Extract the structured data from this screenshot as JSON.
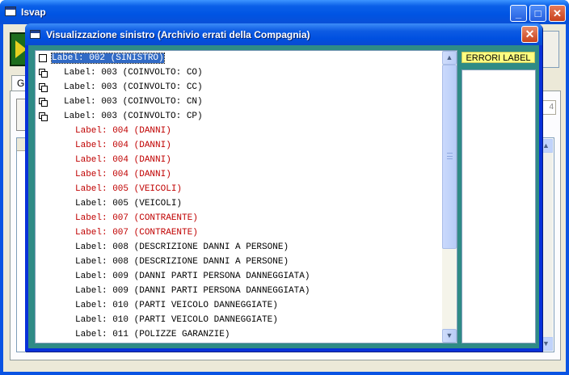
{
  "main_window": {
    "title": "Isvap",
    "tab_label": "G",
    "field_value": "4",
    "minimize_glyph": "_",
    "maximize_glyph": "□",
    "close_glyph": "✕"
  },
  "dialog": {
    "title": "Visualizzazione sinistro (Archivio errati della Compagnia)",
    "close_glyph": "✕",
    "errors_header": "ERRORI LABEL",
    "tree_rows": [
      {
        "text": "Label: 002 (SINISTRO)",
        "level": 0,
        "error": false,
        "selected": true,
        "expander": "box"
      },
      {
        "text": "Label: 003 (COINVOLTO: CO)",
        "level": 1,
        "error": false,
        "selected": false,
        "expander": "node"
      },
      {
        "text": "Label: 003 (COINVOLTO: CC)",
        "level": 1,
        "error": false,
        "selected": false,
        "expander": "node"
      },
      {
        "text": "Label: 003 (COINVOLTO: CN)",
        "level": 1,
        "error": false,
        "selected": false,
        "expander": "node"
      },
      {
        "text": "Label: 003 (COINVOLTO: CP)",
        "level": 1,
        "error": false,
        "selected": false,
        "expander": "node"
      },
      {
        "text": "Label: 004 (DANNI)",
        "level": 2,
        "error": true,
        "selected": false,
        "expander": ""
      },
      {
        "text": "Label: 004 (DANNI)",
        "level": 2,
        "error": true,
        "selected": false,
        "expander": ""
      },
      {
        "text": "Label: 004 (DANNI)",
        "level": 2,
        "error": true,
        "selected": false,
        "expander": ""
      },
      {
        "text": "Label: 004 (DANNI)",
        "level": 2,
        "error": true,
        "selected": false,
        "expander": ""
      },
      {
        "text": "Label: 005 (VEICOLI)",
        "level": 2,
        "error": true,
        "selected": false,
        "expander": ""
      },
      {
        "text": "Label: 005 (VEICOLI)",
        "level": 2,
        "error": false,
        "selected": false,
        "expander": ""
      },
      {
        "text": "Label: 007 (CONTRAENTE)",
        "level": 2,
        "error": true,
        "selected": false,
        "expander": ""
      },
      {
        "text": "Label: 007 (CONTRAENTE)",
        "level": 2,
        "error": true,
        "selected": false,
        "expander": ""
      },
      {
        "text": "Label: 008 (DESCRIZIONE DANNI A PERSONE)",
        "level": 2,
        "error": false,
        "selected": false,
        "expander": ""
      },
      {
        "text": "Label: 008 (DESCRIZIONE DANNI A PERSONE)",
        "level": 2,
        "error": false,
        "selected": false,
        "expander": ""
      },
      {
        "text": "Label: 009 (DANNI PARTI PERSONA DANNEGGIATA)",
        "level": 2,
        "error": false,
        "selected": false,
        "expander": ""
      },
      {
        "text": "Label: 009 (DANNI PARTI PERSONA DANNEGGIATA)",
        "level": 2,
        "error": false,
        "selected": false,
        "expander": ""
      },
      {
        "text": "Label: 010 (PARTI VEICOLO DANNEGGIATE)",
        "level": 2,
        "error": false,
        "selected": false,
        "expander": ""
      },
      {
        "text": "Label: 010 (PARTI VEICOLO DANNEGGIATE)",
        "level": 2,
        "error": false,
        "selected": false,
        "expander": ""
      },
      {
        "text": "Label: 011 (POLIZZE GARANZIE)",
        "level": 2,
        "error": false,
        "selected": false,
        "expander": ""
      }
    ],
    "error_items": []
  },
  "colors": {
    "error_text": "#c00000",
    "selection": "#316ac5",
    "dialog_client": "#2f8b86",
    "errors_header_bg": "#ffff80"
  },
  "icons": {
    "scroll_up": "▲",
    "scroll_down": "▼"
  }
}
